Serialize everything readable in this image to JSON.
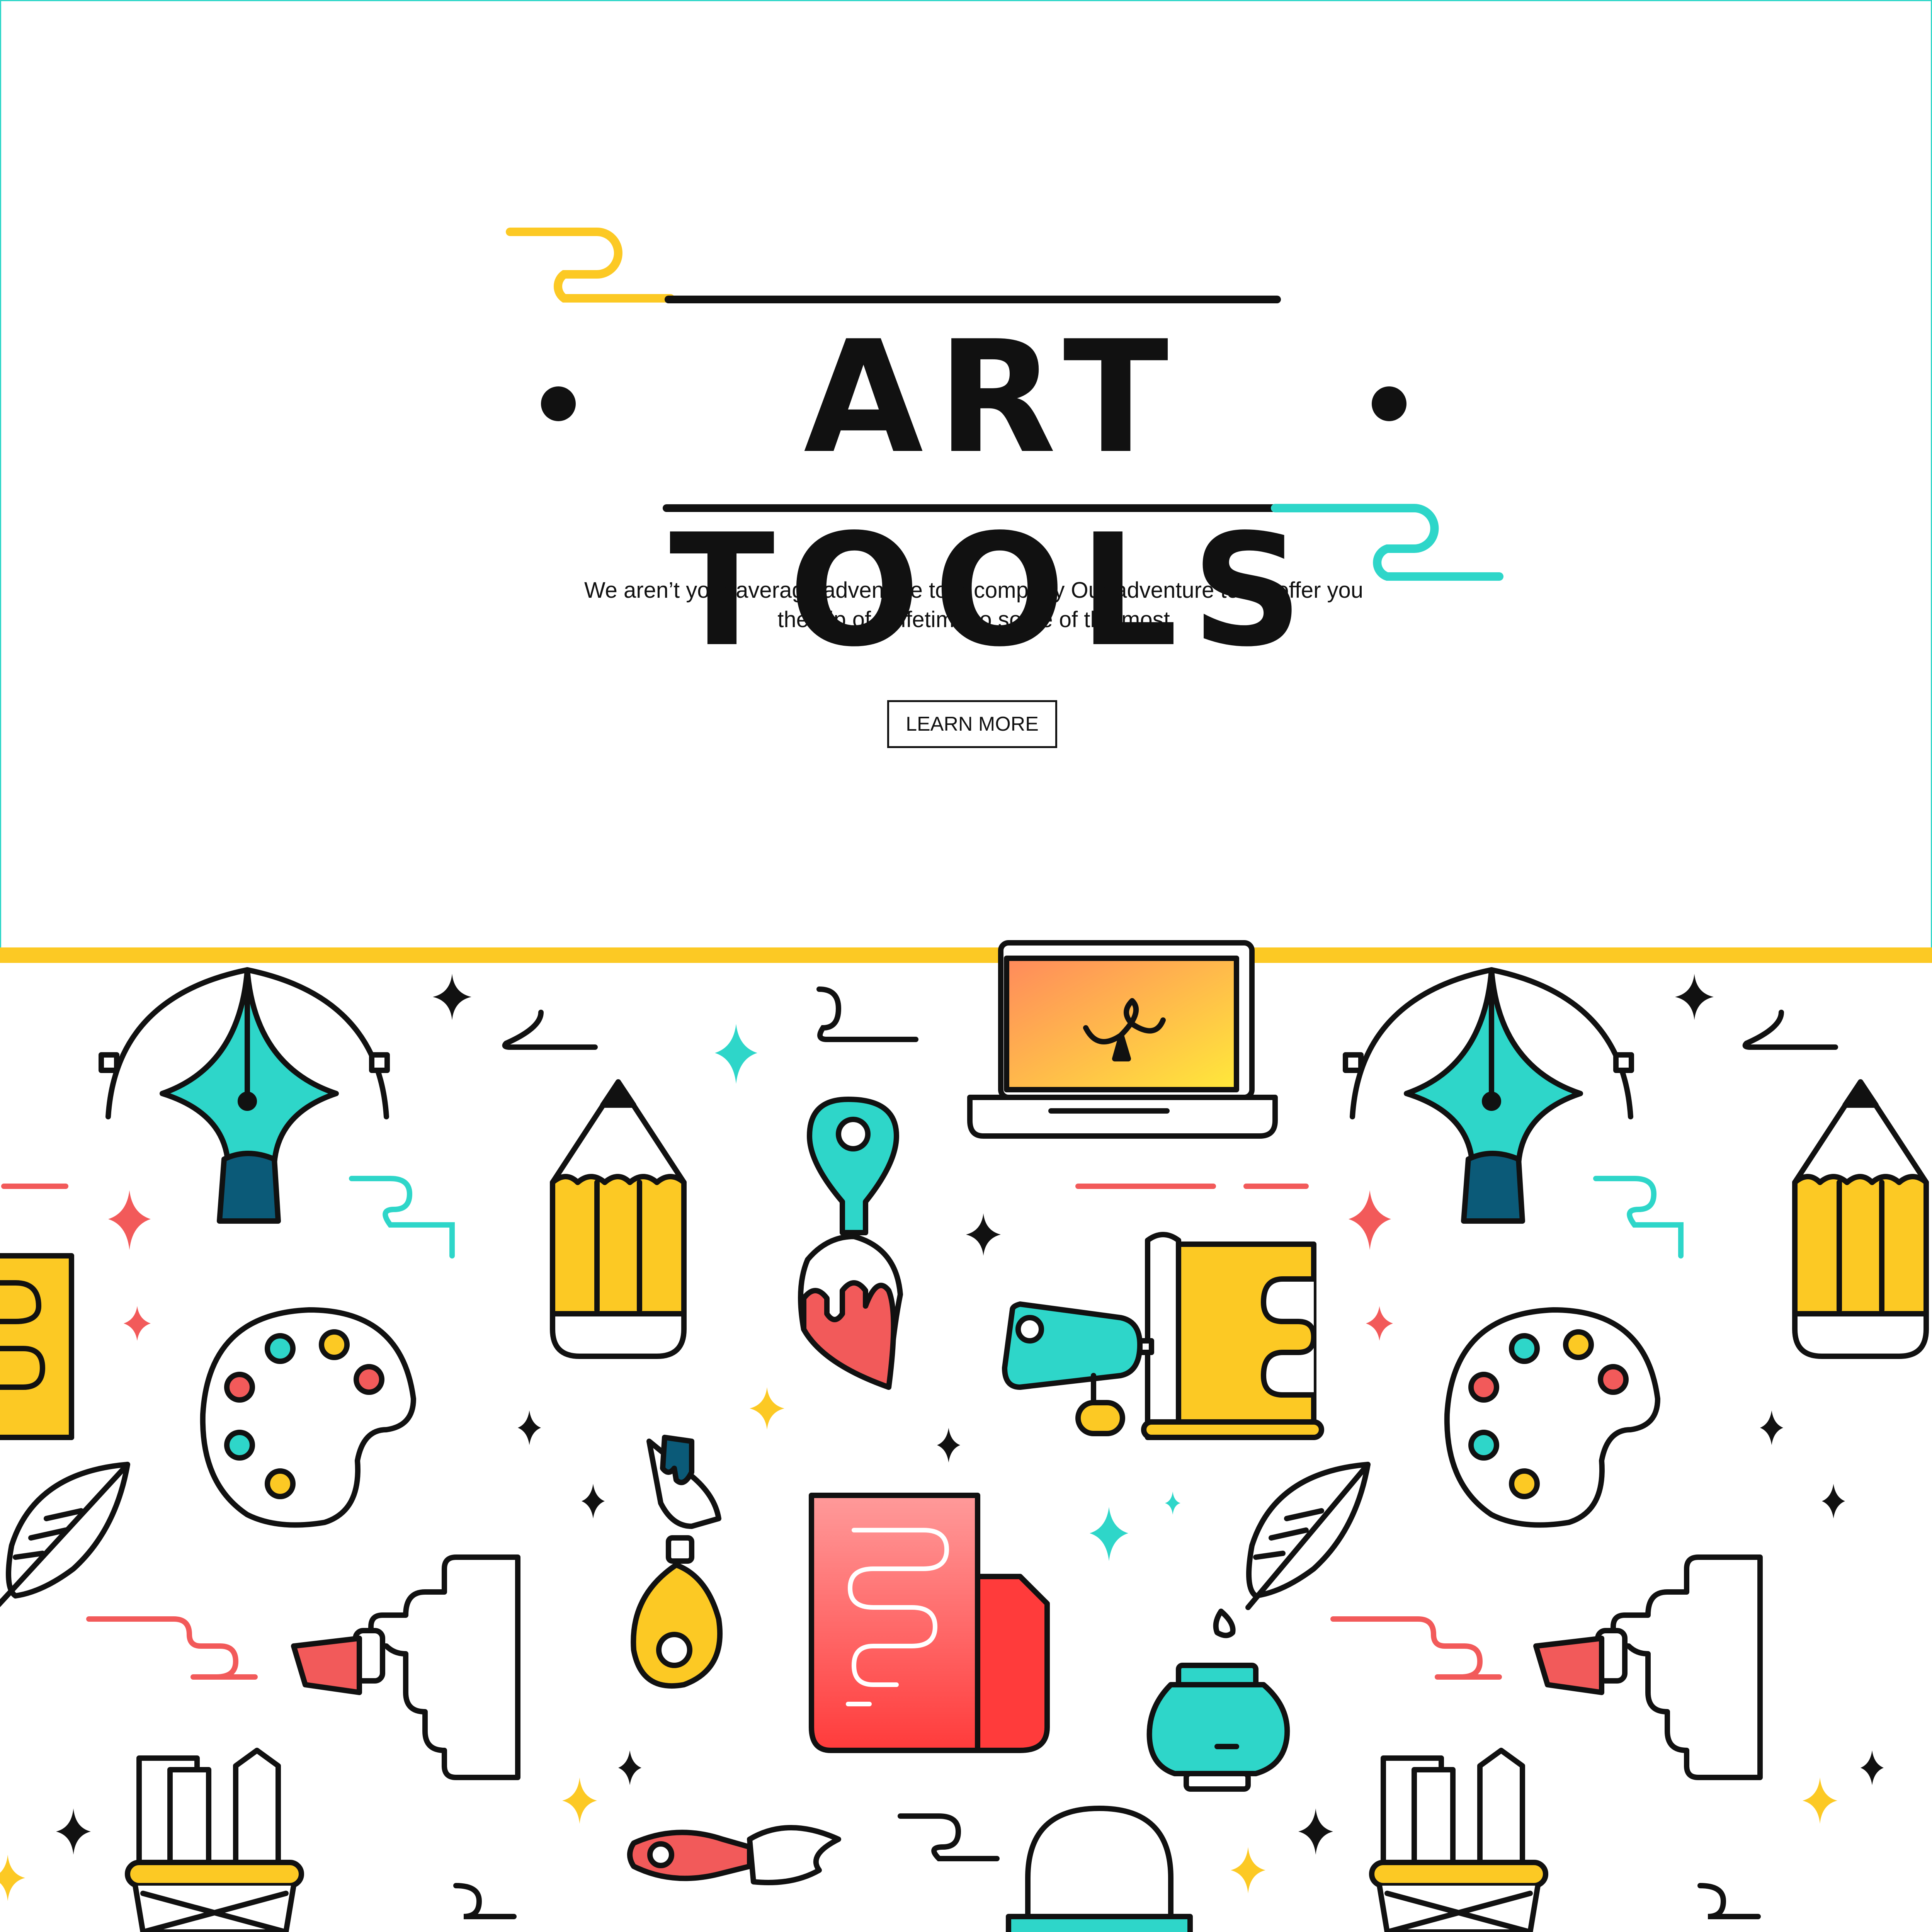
{
  "hero": {
    "title": "ART TOOLS",
    "tagline": "We aren’t your average adventure tour company  Our adventure tours offer you the trip of a lifetime to some of the most",
    "cta_label": "LEARN MORE"
  },
  "colors": {
    "accent_yellow": "#fcc924",
    "accent_teal": "#2ed6c9",
    "accent_red": "#f25a5a",
    "dark_teal": "#0b5a78",
    "ink": "#111111"
  },
  "pattern_icons": [
    "pen-nib-icon",
    "pencil-icon",
    "paintbrush-icon",
    "laptop-icon",
    "palette-icon",
    "paint-tube-icon",
    "ink-pen-icon",
    "paper-scroll-icon",
    "feather-quill-icon",
    "ink-bottle-icon",
    "glue-bottle-icon",
    "pencil-cup-icon",
    "sparkle-icon"
  ]
}
